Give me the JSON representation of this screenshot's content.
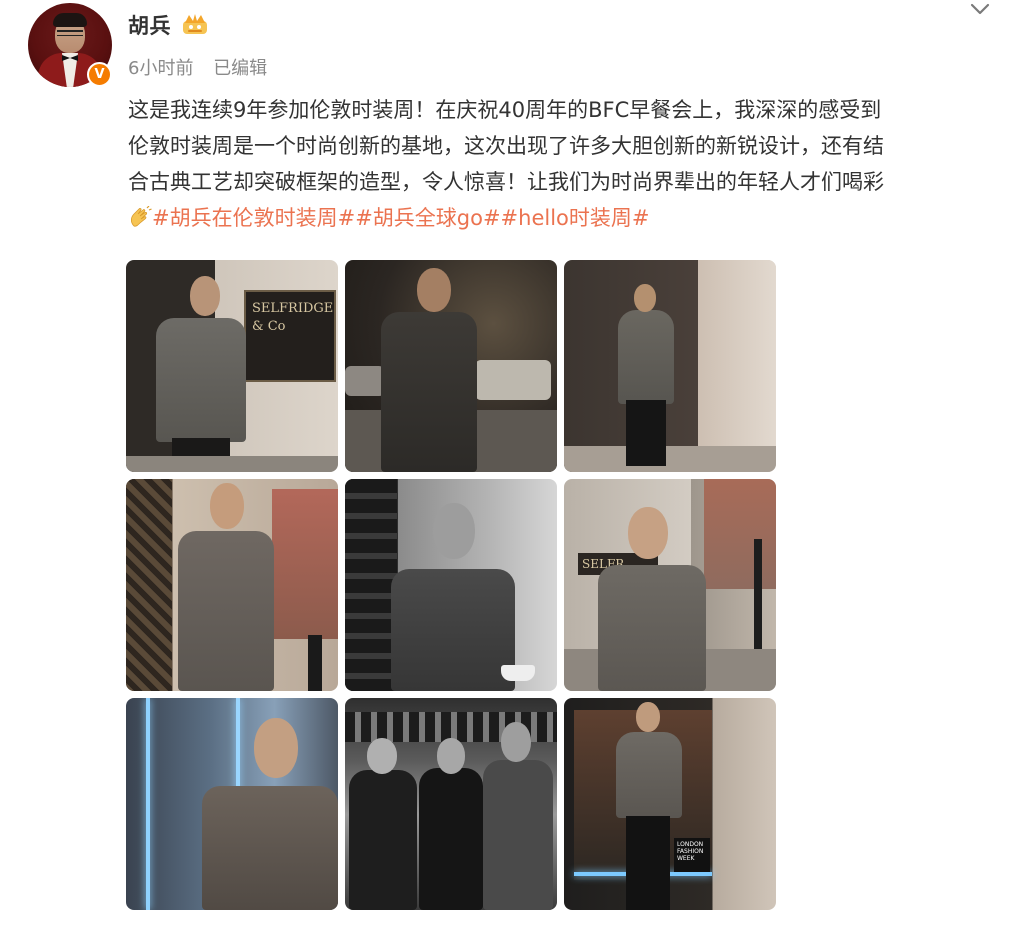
{
  "author": {
    "name": "胡兵",
    "verified_badge": "V",
    "time_ago": "6小时前",
    "edited_label": "已编辑"
  },
  "post": {
    "lines": [
      "这是我连续9年参加伦敦时装周！在庆祝40周年的BFC早餐会上，我深深的感受到",
      "伦敦时装周是一个时尚创新的基地，这次出现了许多大胆创新的新锐设计，还有结",
      "合古典工艺却突破框架的造型，令人惊喜！让我们为时尚界辈出的年轻人才们喝彩"
    ],
    "hashtags": "#胡兵在伦敦时装周##胡兵全球go##hello时装周#"
  },
  "icons": {
    "crown": "crown-icon",
    "clap": "clap-icon",
    "chevron": "chevron-down-icon"
  },
  "colors": {
    "hashtag": "#eb7350",
    "badge": "#f57c00",
    "meta": "#8a8a8a"
  },
  "photos": [
    {
      "name": "photo-1",
      "sign_text": "SELFRIDGE\n& Co"
    },
    {
      "name": "photo-2"
    },
    {
      "name": "photo-3"
    },
    {
      "name": "photo-4"
    },
    {
      "name": "photo-5"
    },
    {
      "name": "photo-6",
      "sign_text": "SELFR"
    },
    {
      "name": "photo-7"
    },
    {
      "name": "photo-8"
    },
    {
      "name": "photo-9",
      "sign_text": "LONDON\nFASHION\nWEEK"
    }
  ]
}
